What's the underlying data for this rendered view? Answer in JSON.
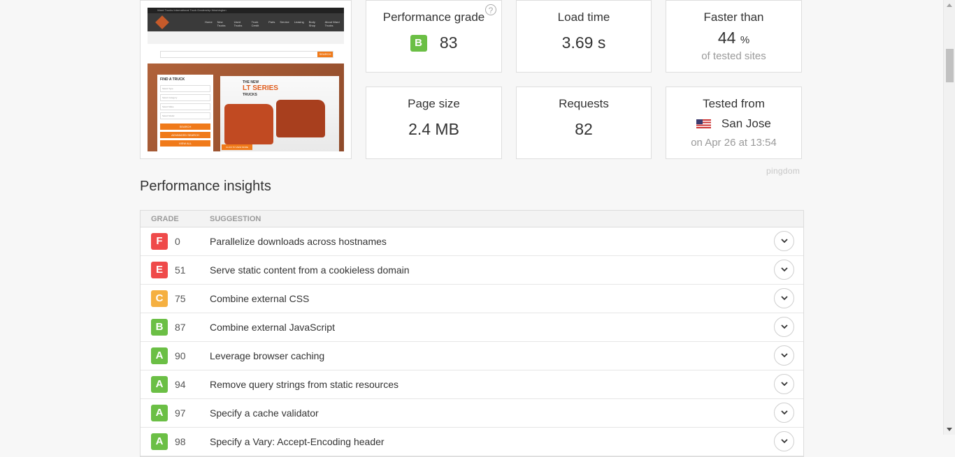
{
  "summary": {
    "performance_grade": {
      "label": "Performance grade",
      "grade": "B",
      "score": "83",
      "grade_color": "#6bbf45"
    },
    "load_time": {
      "label": "Load time",
      "value": "3.69 s"
    },
    "faster_than": {
      "label": "Faster than",
      "value": "44",
      "unit": "%",
      "sub": "of tested sites"
    },
    "page_size": {
      "label": "Page size",
      "value": "2.4 MB"
    },
    "requests": {
      "label": "Requests",
      "value": "82"
    },
    "tested_from": {
      "label": "Tested from",
      "location": "San Jose",
      "flag": "us-flag-icon",
      "sub": "on Apr 26 at 13:54"
    }
  },
  "thumbnail": {
    "topbar_text": "Ward Trucks International Truck Dealership Washington",
    "nav": [
      "Home",
      "New Trucks",
      "Used Trucks",
      "Truck Credit",
      "Parts",
      "Service",
      "Leasing",
      "Body Shop",
      "About Ward Trucks"
    ],
    "search_button": "SEARCH",
    "find_a_truck": "FIND A TRUCK",
    "selects": [
      "Select Type",
      "Select Category",
      "Select Make",
      "Select Model"
    ],
    "buttons": [
      "SEARCH",
      "ADVANCED SEARCH",
      "VIEW ALL"
    ],
    "hero_line1": "THE NEW",
    "hero_line2": "LT SERIES",
    "hero_line3": "TRUCKS",
    "hero_cta": "CLICK TO VIEW MORE"
  },
  "brand": "pingdom",
  "insights": {
    "title": "Performance insights",
    "columns": {
      "grade": "GRADE",
      "suggestion": "SUGGESTION"
    },
    "rows": [
      {
        "grade": "F",
        "score": "0",
        "suggestion": "Parallelize downloads across hostnames",
        "color": "#ef4a4a"
      },
      {
        "grade": "E",
        "score": "51",
        "suggestion": "Serve static content from a cookieless domain",
        "color": "#ef4a4a"
      },
      {
        "grade": "C",
        "score": "75",
        "suggestion": "Combine external CSS",
        "color": "#f5b041"
      },
      {
        "grade": "B",
        "score": "87",
        "suggestion": "Combine external JavaScript",
        "color": "#6bbf45"
      },
      {
        "grade": "A",
        "score": "90",
        "suggestion": "Leverage browser caching",
        "color": "#6bbf45"
      },
      {
        "grade": "A",
        "score": "94",
        "suggestion": "Remove query strings from static resources",
        "color": "#6bbf45"
      },
      {
        "grade": "A",
        "score": "97",
        "suggestion": "Specify a cache validator",
        "color": "#6bbf45"
      },
      {
        "grade": "A",
        "score": "98",
        "suggestion": "Specify a Vary: Accept-Encoding header",
        "color": "#6bbf45"
      }
    ]
  }
}
